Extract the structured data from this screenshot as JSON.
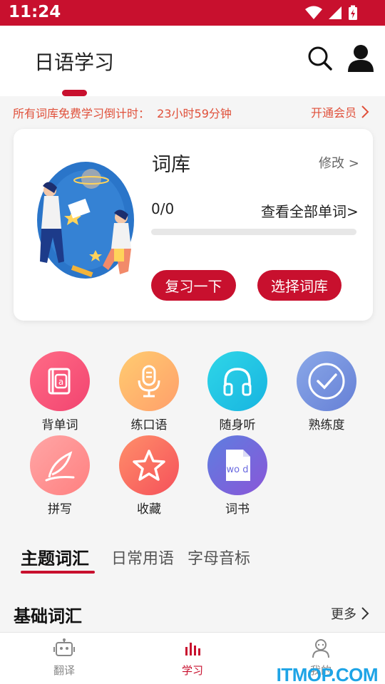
{
  "status_bar": {
    "time": "11:24",
    "icons": [
      "wifi-icon",
      "signal-icon",
      "battery-icon"
    ]
  },
  "header": {
    "title": "日语学习",
    "icons": [
      "search-icon",
      "profile-icon"
    ]
  },
  "promo": {
    "countdown_text": "所有词库免费学习倒计时：  23小时59分钟",
    "vip_label": "开通会员"
  },
  "vocab_card": {
    "title": "词库",
    "edit_label": "修改 >",
    "progress_text": "0/0",
    "progress_fraction": 0,
    "view_all_label": "查看全部单词>",
    "review_label": "复习一下",
    "choose_label": "选择词库"
  },
  "functions": [
    {
      "label": "背单词",
      "icon": "book-icon",
      "color_from": "#ff6b86",
      "color_to": "#f24470"
    },
    {
      "label": "练口语",
      "icon": "microphone-icon",
      "color_from": "#ffcc70",
      "color_to": "#ff9f6b"
    },
    {
      "label": "随身听",
      "icon": "headphones-icon",
      "color_from": "#2fd6e8",
      "color_to": "#17b4e0"
    },
    {
      "label": "熟练度",
      "icon": "check-circle-icon",
      "color_from": "#8aa8e8",
      "color_to": "#6680d6"
    },
    {
      "label": "拼写",
      "icon": "quill-icon",
      "color_from": "#ffa6a6",
      "color_to": "#ff8080"
    },
    {
      "label": "收藏",
      "icon": "star-icon",
      "color_from": "#ff8f6a",
      "color_to": "#f5505a"
    },
    {
      "label": "词书",
      "icon": "word-file-icon",
      "color_from": "#5d7fe0",
      "color_to": "#8a55d8"
    }
  ],
  "tabs": [
    {
      "label": "主题词汇",
      "active": true
    },
    {
      "label": "日常用语",
      "active": false
    },
    {
      "label": "字母音标",
      "active": false
    }
  ],
  "section": {
    "title": "基础词汇",
    "more_label": "更多"
  },
  "bottom_nav": [
    {
      "label": "翻译",
      "icon": "robot-icon",
      "active": false
    },
    {
      "label": "学习",
      "icon": "chart-icon",
      "active": true
    },
    {
      "label": "我的",
      "icon": "user-icon",
      "active": false
    }
  ],
  "watermark": "ITMOP.COM",
  "accent_color": "#c8102e"
}
